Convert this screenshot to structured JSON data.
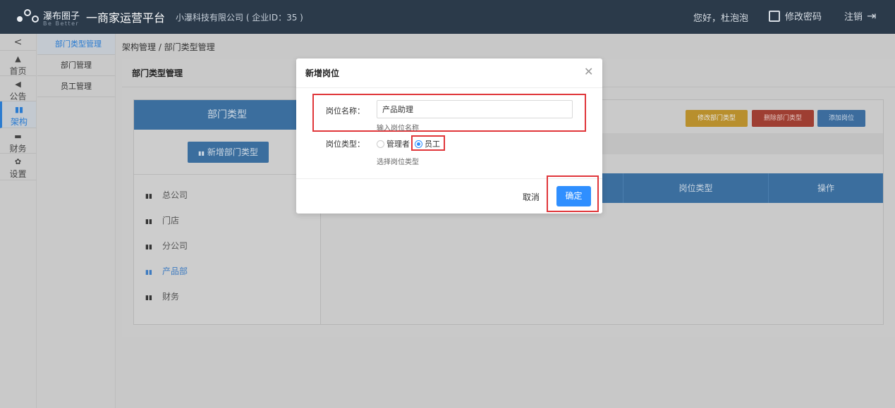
{
  "header": {
    "brand": "瀑布圈子",
    "brand_sub": "Be Better",
    "platform": "一商家运营平台",
    "company": "小瀑科技有限公司 ( 企业ID：35 )",
    "greeting": "您好，杜泡泡",
    "change_password": "修改密码",
    "logout": "注销"
  },
  "leftnav": {
    "collapse": "<",
    "items": [
      {
        "label": "首页",
        "icon": "home-icon"
      },
      {
        "label": "公告",
        "icon": "megaphone-icon"
      },
      {
        "label": "架构",
        "icon": "bar-chart-icon"
      },
      {
        "label": "财务",
        "icon": "money-icon"
      },
      {
        "label": "设置",
        "icon": "gear-icon"
      }
    ]
  },
  "subnav": {
    "items": [
      {
        "label": "部门类型管理"
      },
      {
        "label": "部门管理"
      },
      {
        "label": "员工管理"
      }
    ]
  },
  "breadcrumb": "架构管理  /  部门类型管理",
  "panel": {
    "title": "部门类型管理",
    "dept_header": "部门类型",
    "add_dept_button": "新增部门类型",
    "depts": [
      "总公司",
      "门店",
      "分公司",
      "产品部",
      "财务"
    ],
    "edit_button": "修改部门类型",
    "delete_button": "删除部门类型",
    "add_position_button": "添加岗位",
    "table_headers": [
      "岗位类型",
      "操作"
    ]
  },
  "modal": {
    "title": "新增岗位",
    "name_label": "岗位名称：",
    "name_value": "产品助理",
    "name_help": "输入岗位名称",
    "type_label": "岗位类型：",
    "type_options": [
      "管理者",
      "员工"
    ],
    "type_selected": "员工",
    "type_help": "选择岗位类型",
    "cancel": "取消",
    "confirm": "确定"
  },
  "colors": {
    "topbar": "#2b3a4a",
    "primary": "#2f8fff",
    "highlight": "#e0363a"
  }
}
